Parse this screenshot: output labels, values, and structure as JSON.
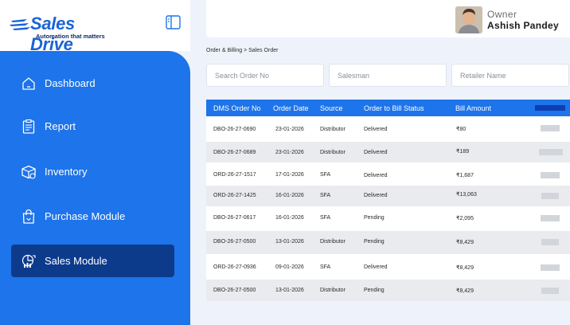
{
  "brand": {
    "name": "Sales Drive",
    "tagline": "Automation that matters"
  },
  "sidebar": {
    "items": [
      {
        "label": "Dashboard",
        "icon": "home-icon",
        "active": false
      },
      {
        "label": "Report",
        "icon": "clipboard-icon",
        "active": false
      },
      {
        "label": "Inventory",
        "icon": "box-icon",
        "active": false
      },
      {
        "label": "Purchase Module",
        "icon": "shopping-bag-icon",
        "active": false
      },
      {
        "label": "Sales Module",
        "icon": "sales-chart-icon",
        "active": true
      }
    ]
  },
  "user": {
    "role": "Owner",
    "name": "Ashish Pandey"
  },
  "breadcrumb": "Order & Billing > Sales Order",
  "filters": {
    "order_no_placeholder": "Search Order No",
    "salesman_placeholder": "Salesman",
    "retailer_placeholder": "Retailer Name"
  },
  "table": {
    "headers": [
      "DMS Order No",
      "Order Date",
      "Source",
      "Order to Bill Status",
      "Bill Amount"
    ],
    "rows": [
      {
        "order_no": "DBO-26-27-0690",
        "date": "23-01-2026",
        "source": "Distributor",
        "status": "Delivered",
        "amount": "₹80"
      },
      {
        "order_no": "DBO-26-27-0689",
        "date": "23-01-2026",
        "source": "Distributor",
        "status": "Delivered",
        "amount": "₹189"
      },
      {
        "order_no": "ORD-26-27-1517",
        "date": "17-01-2026",
        "source": "SFA",
        "status": "Delivered",
        "amount": "₹1,687"
      },
      {
        "order_no": "ORD-26-27-1425",
        "date": "16-01-2026",
        "source": "SFA",
        "status": "Delivered",
        "amount": "₹13,063"
      },
      {
        "order_no": "DBO-26-27-0617",
        "date": "16-01-2026",
        "source": "SFA",
        "status": "Pending",
        "amount": "₹2,095"
      },
      {
        "order_no": "DBO-26-27-0500",
        "date": "13-01-2026",
        "source": "Distributor",
        "status": "Pending",
        "amount": "₹8,429"
      },
      {
        "order_no": "ORD-26-27-0936",
        "date": "09-01-2026",
        "source": "SFA",
        "status": "Delivered",
        "amount": "₹8,429"
      },
      {
        "order_no": "DBO-26-27-0500",
        "date": "13-01-2026",
        "source": "Distributor",
        "status": "Pending",
        "amount": "₹8,429"
      }
    ]
  },
  "colors": {
    "primary": "#1e74ea",
    "active_nav": "#0d3b8c",
    "page_bg": "#eef3fb"
  }
}
